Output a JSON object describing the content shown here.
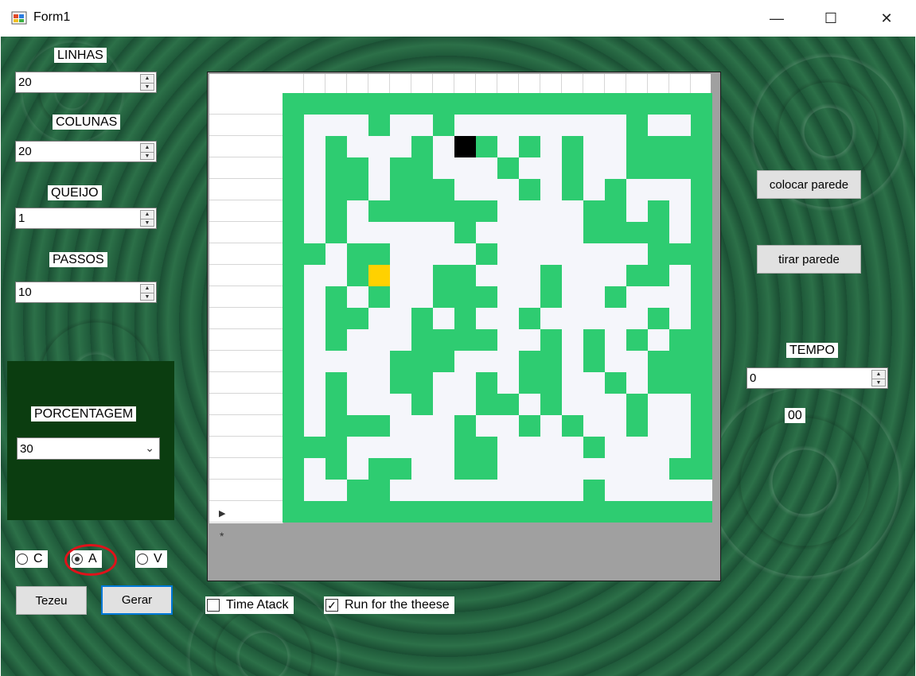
{
  "window": {
    "title": "Form1",
    "minimize": "—",
    "maximize": "☐",
    "close": "✕"
  },
  "fields": {
    "linhas": {
      "label": "LINHAS",
      "value": "20"
    },
    "colunas": {
      "label": "COLUNAS",
      "value": "20"
    },
    "queijo": {
      "label": "QUEIJO",
      "value": "1"
    },
    "passos": {
      "label": "PASSOS",
      "value": "10"
    },
    "porcentagem": {
      "label": "PORCENTAGEM",
      "value": "30"
    },
    "tempo": {
      "label": "TEMPO",
      "value": "0",
      "readout": "00"
    }
  },
  "radios": [
    {
      "label": "C",
      "checked": false
    },
    {
      "label": "A",
      "checked": true
    },
    {
      "label": "V",
      "checked": false
    }
  ],
  "buttons": {
    "tezeu": "Tezeu",
    "gerar": "Gerar",
    "colocar_parede": "colocar parede",
    "tirar_parede": "tirar parede"
  },
  "checkboxes": {
    "time_atack": {
      "label": "Time Atack",
      "checked": false
    },
    "run_cheese": {
      "label": "Run for the theese",
      "checked": true
    }
  },
  "grid_rows": [
    "WWWWWWWWWWWWWWWWWWWW",
    "W...W..W........W..W",
    "W.W...W.RW.W.W..WWWW",
    "W.WW.WW...W..W..WWWW",
    "W.WW.WWW...W.W.W...W",
    "W.W.WWWWWW....WW.W.W",
    "W.W.....W.....WWWW.W",
    "WW.WW....W.......WWW",
    "W..WC..WW...W...WW.W",
    "W.W.W..WWW..W..W...W",
    "W.WW..W.W..W.....W.W",
    "W.W...WWWW..W.W.W.WW",
    "W....WWW...WW.W..WWW",
    "W.W..WW..W.WW..W.WWW",
    "W.W...W..WW.W...W..W",
    "W.WWW...W..W.W..W..W",
    "WWW.....WW....W....W",
    "W.W.WW..WW........WW",
    "W..WW.........W.....",
    "WWWWWWWWWWWWWWWWWWWW"
  ],
  "colors": {
    "wall": "#2ecc71",
    "floor": "#f5f6fb",
    "rat": "#000000",
    "cheese": "#ffd100",
    "panel": "#0b3d10"
  }
}
